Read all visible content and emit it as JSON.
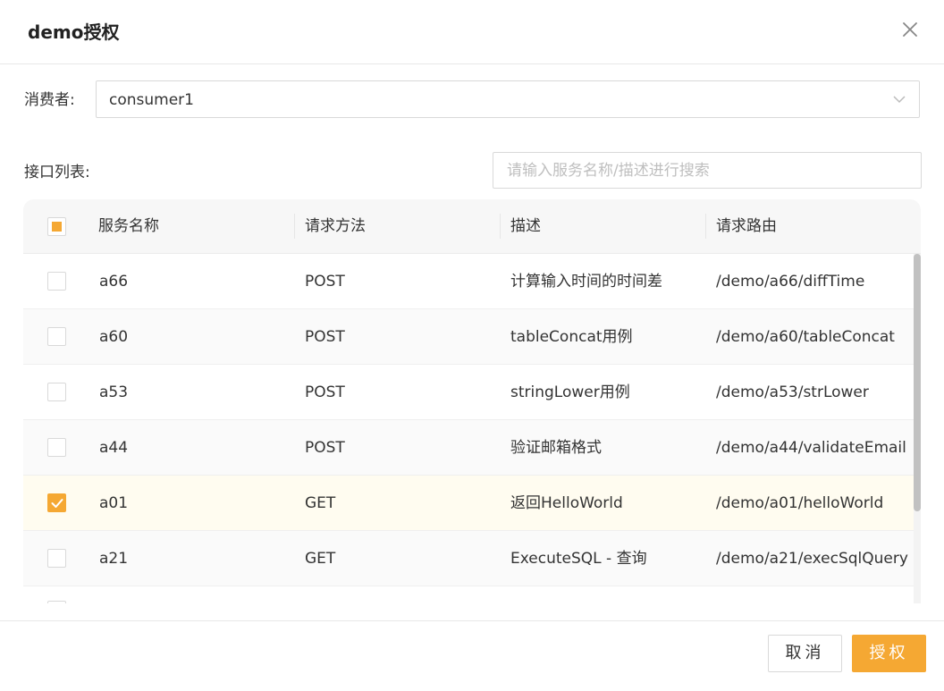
{
  "dialog": {
    "title": "demo授权",
    "close_icon": "close-icon"
  },
  "consumer": {
    "label": "消费者:",
    "selected": "consumer1"
  },
  "api_list": {
    "label": "接口列表:",
    "search_placeholder": "请输入服务名称/描述进行搜索"
  },
  "table": {
    "columns": [
      "服务名称",
      "请求方法",
      "描述",
      "请求路由"
    ],
    "rows": [
      {
        "name": "a66",
        "method": "POST",
        "desc": "计算输入时间的时间差",
        "route": "/demo/a66/diffTime",
        "checked": false
      },
      {
        "name": "a60",
        "method": "POST",
        "desc": "tableConcat用例",
        "route": "/demo/a60/tableConcat",
        "checked": false
      },
      {
        "name": "a53",
        "method": "POST",
        "desc": "stringLower用例",
        "route": "/demo/a53/strLower",
        "checked": false
      },
      {
        "name": "a44",
        "method": "POST",
        "desc": "验证邮箱格式",
        "route": "/demo/a44/validateEmail",
        "checked": false
      },
      {
        "name": "a01",
        "method": "GET",
        "desc": "返回HelloWorld",
        "route": "/demo/a01/helloWorld",
        "checked": true
      },
      {
        "name": "a21",
        "method": "GET",
        "desc": "ExecuteSQL - 查询",
        "route": "/demo/a21/execSqlQuery",
        "checked": false
      }
    ]
  },
  "footer": {
    "cancel_label": "取消",
    "ok_label": "授权"
  },
  "colors": {
    "accent": "#f5a833",
    "selected_row": "#fffcf0"
  }
}
